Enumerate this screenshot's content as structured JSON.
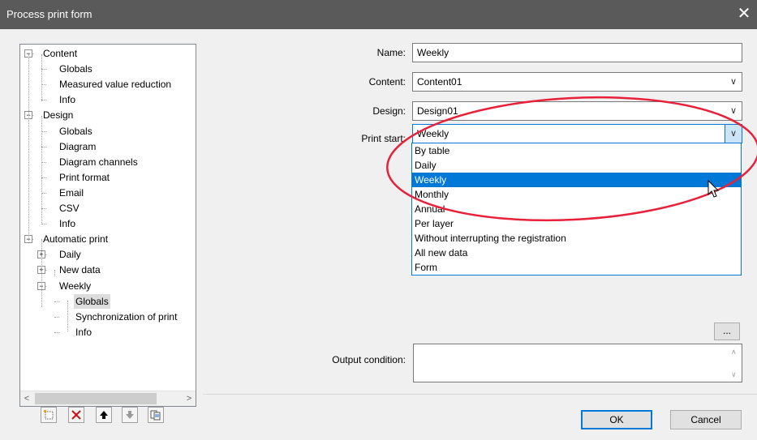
{
  "window": {
    "title": "Process print form",
    "close_glyph": "✕"
  },
  "tree": {
    "nodes": [
      {
        "label": "Content",
        "expander": "−"
      },
      {
        "label": "Globals"
      },
      {
        "label": "Measured value reduction"
      },
      {
        "label": "Info"
      },
      {
        "label": "Design",
        "expander": "−"
      },
      {
        "label": "Globals"
      },
      {
        "label": "Diagram"
      },
      {
        "label": "Diagram channels"
      },
      {
        "label": "Print format"
      },
      {
        "label": "Email"
      },
      {
        "label": "CSV"
      },
      {
        "label": "Info"
      },
      {
        "label": "Automatic print",
        "expander": "−"
      },
      {
        "label": "Daily",
        "expander": "+"
      },
      {
        "label": "New data",
        "expander": "+"
      },
      {
        "label": "Weekly",
        "expander": "−"
      },
      {
        "label": "Globals",
        "selected": true
      },
      {
        "label": "Synchronization of print"
      },
      {
        "label": "Info"
      }
    ],
    "scroll_left": "<",
    "scroll_right": ">"
  },
  "toolbar": {
    "new_icon": "new-item-icon",
    "delete_icon": "delete-icon",
    "up_icon": "move-up-icon",
    "down_icon": "move-down-icon",
    "copy_icon": "copy-icon"
  },
  "form": {
    "name": {
      "label": "Name:",
      "value": "Weekly"
    },
    "content": {
      "label": "Content:",
      "value": "Content01"
    },
    "design": {
      "label": "Design:",
      "value": "Design01"
    },
    "print_start": {
      "label": "Print start:",
      "value": "Weekly",
      "options": [
        "By table",
        "Daily",
        "Weekly",
        "Monthly",
        "Annual",
        "Per layer",
        "Without interrupting the registration",
        "All new data",
        "Form"
      ],
      "selected_index": 2
    },
    "ellipsis_label": "...",
    "output_condition": {
      "label": "Output condition:",
      "value": ""
    }
  },
  "buttons": {
    "ok": "OK",
    "cancel": "Cancel"
  },
  "colors": {
    "titlebar": "#5a5a5a",
    "accent": "#0078d7",
    "annotation": "#e8203a"
  }
}
